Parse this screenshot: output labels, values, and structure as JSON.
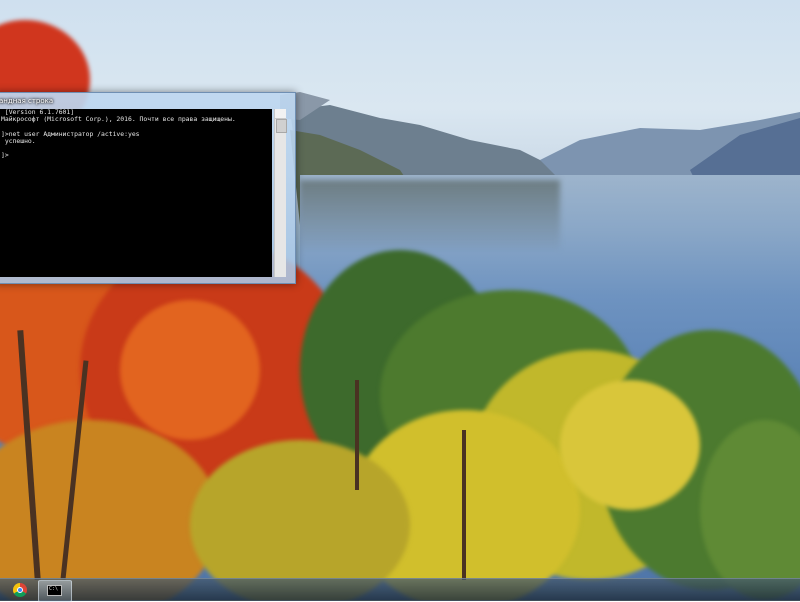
{
  "cmd_window": {
    "title": "андная строка",
    "lines": [
      " [Version 6.1.7601]",
      "Майкрософт (Microsoft Corp.), 2016. Почти все права защищены.",
      "",
      "]>net user Администратор /active:yes",
      " успешно.",
      "",
      "]>"
    ]
  },
  "taskbar": {
    "items": [
      {
        "name": "chrome",
        "icon": "chrome-icon"
      },
      {
        "name": "cmd",
        "icon": "cmd-icon",
        "glyph": "C:\\"
      }
    ]
  },
  "colors": {
    "console_bg": "#000000",
    "console_text": "#e8e8e8",
    "window_frame": "#b8d2ee"
  }
}
